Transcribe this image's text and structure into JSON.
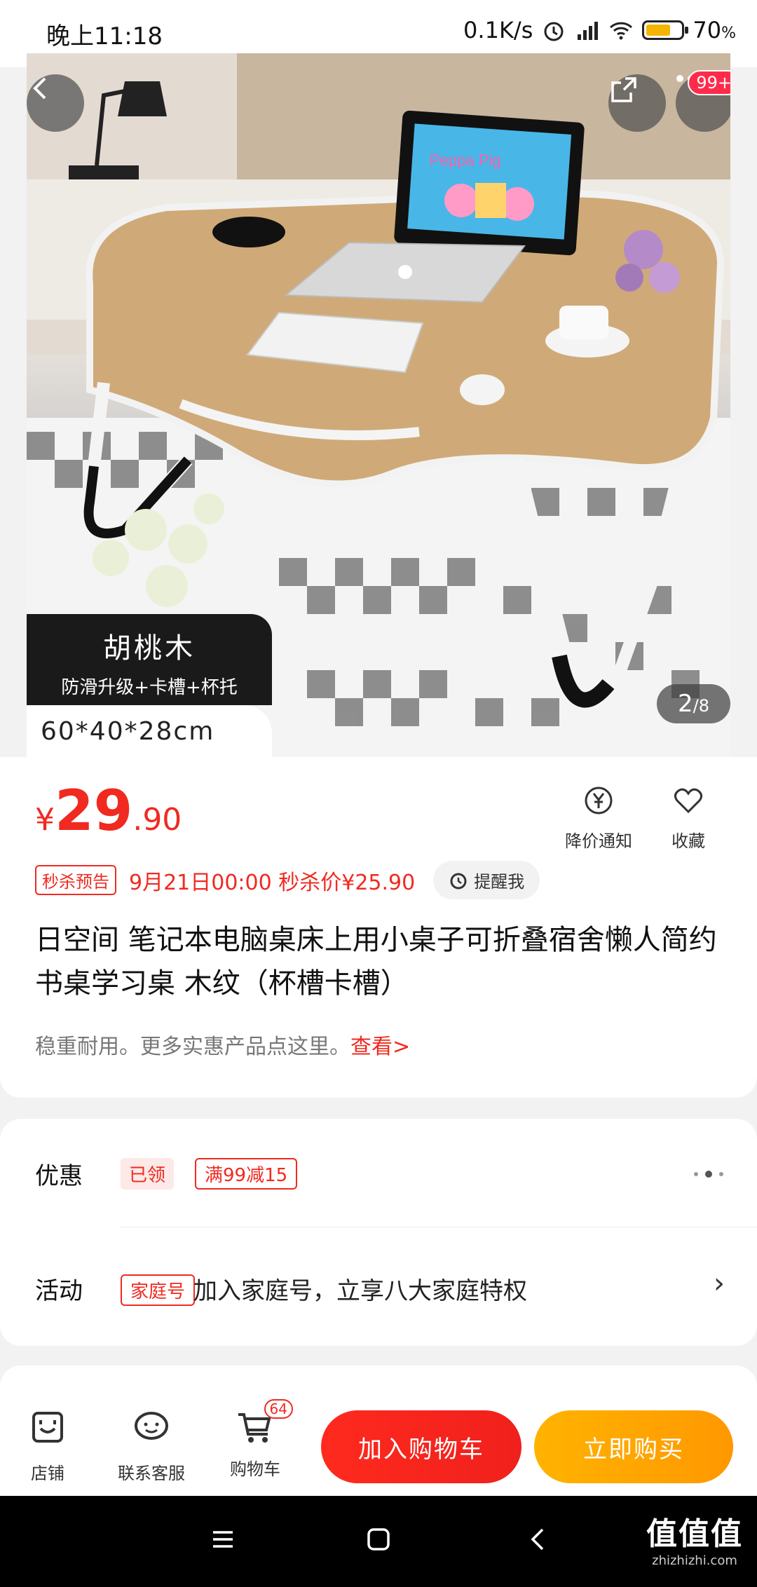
{
  "status_bar": {
    "time": "晚上11:18",
    "speed": "0.1K/s",
    "battery_text": "70",
    "battery_unit": "%",
    "battery_level": 0.7
  },
  "hero": {
    "label_main": "胡桃木",
    "label_sub": "防滑升级+卡槽+杯托",
    "dimensions": "60*40*28cm",
    "pager_current": "2",
    "pager_total": "/8",
    "more_badge": "99+",
    "tablet_text": "Peppa Pig"
  },
  "product": {
    "currency": "¥",
    "price_int": "29",
    "price_dec": ".90",
    "price_alert": "降价通知",
    "favorite": "收藏",
    "flash_tag": "秒杀预告",
    "flash_text": "9月21日00:00 秒杀价¥25.90",
    "remind_label": "提醒我",
    "title": "日空间 笔记本电脑桌床上用小桌子可折叠宿舍懒人简约书桌学习桌 木纹（杯槽卡槽）",
    "sub_text": "稳重耐用。更多实惠产品点这里。",
    "sub_link": "查看>"
  },
  "promo": {
    "discount_label": "优惠",
    "claimed_tag": "已领",
    "coupon": "满99减15",
    "activity_label": "活动",
    "family_tag": "家庭号",
    "activity_text": "加入家庭号，立享八大家庭特权",
    "chevron": "›"
  },
  "bottom_bar": {
    "shop": "店铺",
    "service": "联系客服",
    "cart": "购物车",
    "cart_count": "64",
    "add_to_cart": "加入购物车",
    "buy_now": "立即购买"
  },
  "watermark": {
    "main": "值值值",
    "sub": "zhizhizhi.com"
  },
  "colors": {
    "accent": "#f02a20",
    "buy": "#ffa000"
  }
}
